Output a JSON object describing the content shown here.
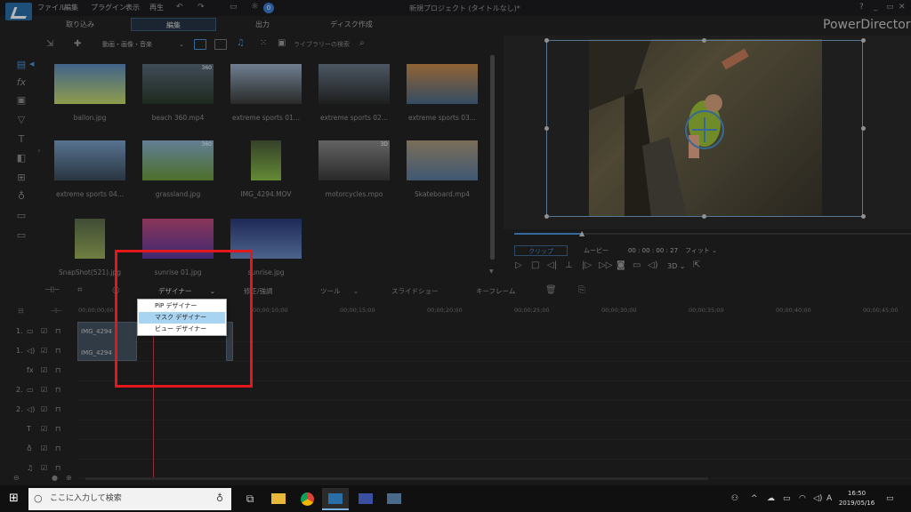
{
  "app": {
    "brand": "PowerDirector",
    "project_title": "新規プロジェクト (タイトルなし)*",
    "help": "?",
    "minimize": "_",
    "maximize": "▭",
    "close": "✕",
    "notify_count": "0"
  },
  "menu": [
    "ファイル",
    "編集",
    "プラグイン",
    "表示",
    "再生"
  ],
  "tabs": [
    {
      "label": "取り込み",
      "active": false
    },
    {
      "label": "編集",
      "active": true
    },
    {
      "label": "出力",
      "active": false
    },
    {
      "label": "ディスク作成",
      "active": false
    }
  ],
  "library": {
    "filter": "動画・画像・音楽",
    "search_placeholder": "ライブラリーの検索",
    "items": [
      {
        "label": "ballon.jpg",
        "badge": ""
      },
      {
        "label": "beach 360.mp4",
        "badge": "360"
      },
      {
        "label": "extreme sports 01...",
        "badge": ""
      },
      {
        "label": "extreme sports 02...",
        "badge": ""
      },
      {
        "label": "extreme sports 03...",
        "badge": ""
      },
      {
        "label": "extreme sports 04...",
        "badge": ""
      },
      {
        "label": "grassland.jpg",
        "badge": "360"
      },
      {
        "label": "IMG_4294.MOV",
        "badge": ""
      },
      {
        "label": "motorcycles.mpo",
        "badge": "3D"
      },
      {
        "label": "Skateboard.mp4",
        "badge": ""
      },
      {
        "label": "SnapShot(521).jpg",
        "badge": ""
      },
      {
        "label": "sunrise 01.jpg",
        "badge": ""
      },
      {
        "label": "sunrise.jpg",
        "badge": ""
      }
    ]
  },
  "preview": {
    "clip_btn": "クリップ",
    "movie_btn": "ムービー",
    "timecode": "00 : 00 : 00 : 27",
    "fit": "フィット",
    "threed": "3D"
  },
  "timeline_toolbar": {
    "designer": "デザイナー",
    "fix": "修正/強調",
    "tools": "ツール",
    "slideshow": "スライドショー",
    "keyframe": "キーフレーム"
  },
  "dropdown": {
    "items": [
      {
        "label": "PiP デザイナー",
        "highlighted": false
      },
      {
        "label": "マスク デザイナー",
        "highlighted": true
      },
      {
        "label": "ビュー デザイナー",
        "highlighted": false
      }
    ]
  },
  "ruler": [
    "00;00;00;00",
    "00;00;05;00",
    "00;00;10;00",
    "00;00;15;00",
    "00;00;20;00",
    "00;00;25;00",
    "00;00;30;00",
    "00;00;35;00",
    "00;00;40;00",
    "00;00;45;00"
  ],
  "tracks": [
    {
      "num": "1.",
      "type": "video"
    },
    {
      "num": "1.",
      "type": "audio"
    },
    {
      "num": "",
      "type": "fx"
    },
    {
      "num": "2.",
      "type": "video"
    },
    {
      "num": "2.",
      "type": "audio"
    },
    {
      "num": "",
      "type": "title"
    },
    {
      "num": "",
      "type": "voice"
    },
    {
      "num": "",
      "type": "music"
    }
  ],
  "clips": {
    "video_label": "IMG_4294",
    "audio_label": "IMG_4294"
  },
  "taskbar": {
    "search_placeholder": "ここに入力して検索",
    "time": "16:50",
    "date": "2019/05/16",
    "ime": "A"
  }
}
